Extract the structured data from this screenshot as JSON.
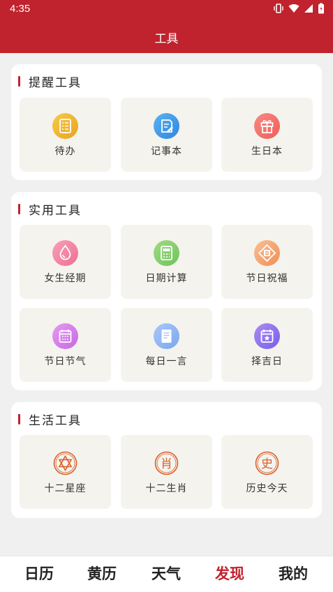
{
  "status_bar": {
    "time": "4:35"
  },
  "header": {
    "title": "工具"
  },
  "sections": [
    {
      "title": "提醒工具",
      "items": [
        {
          "label": "待办",
          "icon": "todo-list-icon"
        },
        {
          "label": "记事本",
          "icon": "notebook-icon"
        },
        {
          "label": "生日本",
          "icon": "gift-icon"
        }
      ]
    },
    {
      "title": "实用工具",
      "items": [
        {
          "label": "女生经期",
          "icon": "drop-icon"
        },
        {
          "label": "日期计算",
          "icon": "calculator-icon"
        },
        {
          "label": "节日祝福",
          "icon": "festival-blessing-icon"
        },
        {
          "label": "节日节气",
          "icon": "calendar-icon"
        },
        {
          "label": "每日一言",
          "icon": "document-icon"
        },
        {
          "label": "择吉日",
          "icon": "calendar-star-icon"
        }
      ]
    },
    {
      "title": "生活工具",
      "items": [
        {
          "label": "十二星座",
          "icon": "star-of-david-icon"
        },
        {
          "label": "十二生肖",
          "icon": "zodiac-xiao-icon",
          "glyph": "肖"
        },
        {
          "label": "历史今天",
          "icon": "history-shi-icon",
          "glyph": "史"
        }
      ]
    }
  ],
  "bottom_nav": {
    "items": [
      {
        "label": "日历"
      },
      {
        "label": "黄历"
      },
      {
        "label": "天气"
      },
      {
        "label": "发现",
        "active": true
      },
      {
        "label": "我的"
      }
    ]
  },
  "colors": {
    "brand_red": "#c0232d",
    "tile_bg": "#f5f3ee",
    "page_bg": "#f0f0f0",
    "zodiac_orange": "#d8602c"
  }
}
